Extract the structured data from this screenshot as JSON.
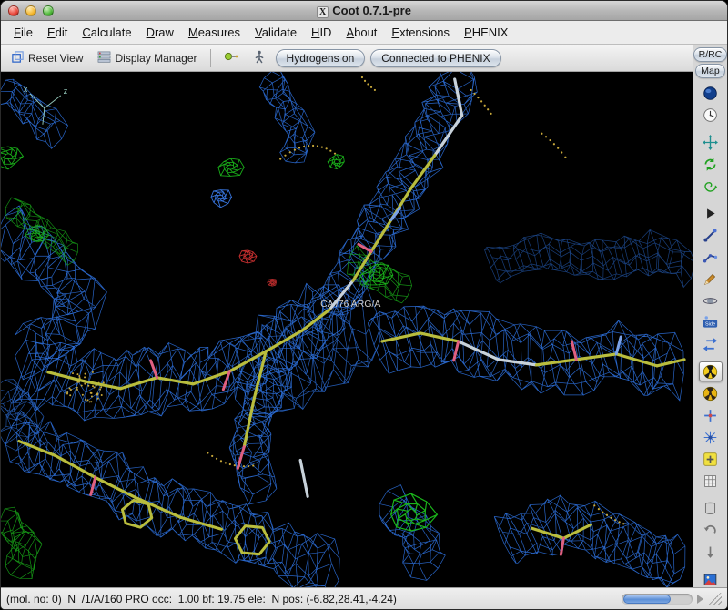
{
  "window": {
    "title": "Coot 0.7.1-pre",
    "app_icon": "X"
  },
  "menubar": {
    "items": [
      {
        "label": "File"
      },
      {
        "label": "Edit"
      },
      {
        "label": "Calculate"
      },
      {
        "label": "Draw"
      },
      {
        "label": "Measures"
      },
      {
        "label": "Validate"
      },
      {
        "label": "HID"
      },
      {
        "label": "About"
      },
      {
        "label": "Extensions"
      },
      {
        "label": "PHENIX"
      }
    ]
  },
  "toolbar": {
    "reset_view": "Reset View",
    "display_manager": "Display Manager",
    "hydrogens_toggle": "Hydrogens on",
    "phenix_status": "Connected to PHENIX"
  },
  "right_panel": {
    "rrc_label": "R/RC",
    "map_label": "Map",
    "icons": [
      {
        "name": "globe-icon",
        "type": "sphere"
      },
      {
        "name": "clock-icon",
        "type": "clock"
      },
      {
        "name": "translate-view-icon",
        "type": "move",
        "gap": true
      },
      {
        "name": "rotate-view-icon",
        "type": "rotate"
      },
      {
        "name": "spin-view-icon",
        "type": "spiral"
      },
      {
        "name": "play-icon",
        "type": "play",
        "gap": true
      },
      {
        "name": "model-stick-icon",
        "type": "stick"
      },
      {
        "name": "fit-atoms-icon",
        "type": "stick2"
      },
      {
        "name": "pencil-icon",
        "type": "pencil"
      },
      {
        "name": "orbit-icon",
        "type": "orbit"
      },
      {
        "name": "side-view-icon",
        "type": "side",
        "label": "Side"
      },
      {
        "name": "flip-arrows-icon",
        "type": "flip"
      },
      {
        "name": "real-space-refine-icon",
        "type": "radiation",
        "selected": true,
        "gap": true
      },
      {
        "name": "regularize-icon",
        "type": "radiation2"
      },
      {
        "name": "rotate-translate-icon",
        "type": "cross"
      },
      {
        "name": "add-atom-icon",
        "type": "staratom"
      },
      {
        "name": "add-terminal-residue-icon",
        "type": "plus"
      },
      {
        "name": "grid-icon",
        "type": "grid"
      },
      {
        "name": "delete-atom-icon",
        "type": "trash",
        "gap": true
      },
      {
        "name": "undo-icon",
        "type": "undo"
      },
      {
        "name": "scroll-down-icon",
        "type": "down"
      },
      {
        "name": "screenshot-icon",
        "type": "flag",
        "gap": true
      }
    ]
  },
  "canvas": {
    "atom_label": "CA /76 ARG/A",
    "axis": {
      "x": "x",
      "z": "z"
    },
    "colors": {
      "mesh_blue": "#2d72e0",
      "density_green": "#1ab51a",
      "density_red": "#cc3030",
      "blob_blue": "#3a7ae8",
      "model_yellow": "#b9bd3d",
      "model_light": "#c8d2da",
      "oxygen_stub": "#e06080",
      "nitrogen_stub": "#7aa2e8",
      "dots_yellow": "#c9a93a",
      "label_text": "#cfcfcf",
      "axis_color": "#9fd6c8"
    }
  },
  "statusbar": {
    "text": "(mol. no: 0)  N  /1/A/160 PRO occ:  1.00 bf: 19.75 ele:  N pos: (-6.82,28.41,-4.24)"
  }
}
